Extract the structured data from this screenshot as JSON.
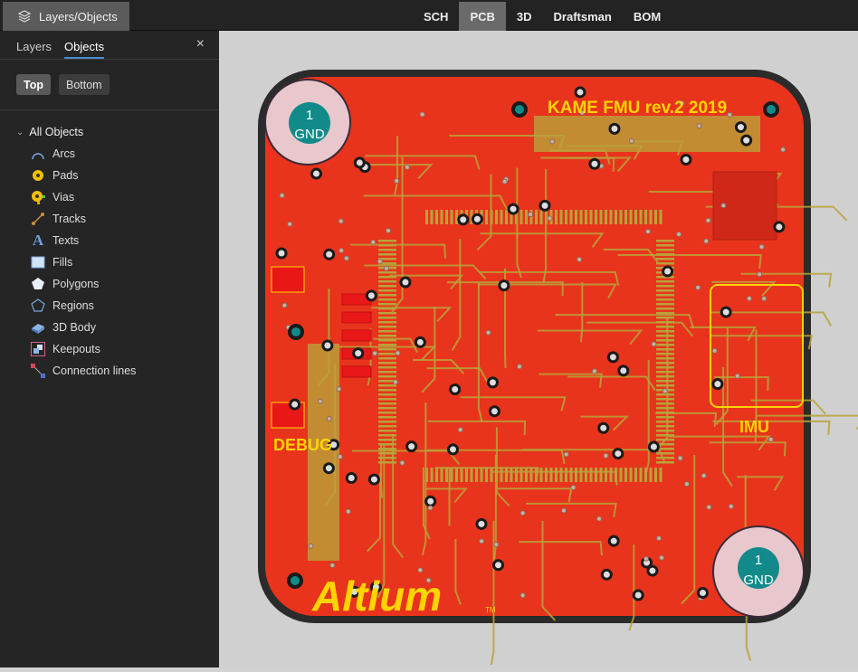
{
  "panel_tab": {
    "label": "Layers/Objects",
    "icon": "layers-icon"
  },
  "doc_tabs": [
    {
      "label": "SCH"
    },
    {
      "label": "PCB",
      "active": true
    },
    {
      "label": "3D"
    },
    {
      "label": "Draftsman"
    },
    {
      "label": "BOM"
    }
  ],
  "sidebar": {
    "tabs": [
      {
        "label": "Layers"
      },
      {
        "label": "Objects",
        "active": true
      }
    ],
    "close": "×",
    "side_buttons": [
      {
        "label": "Top",
        "active": true
      },
      {
        "label": "Bottom"
      }
    ],
    "tree": {
      "root": "All Objects",
      "items": [
        {
          "label": "Arcs",
          "icon": "arc-icon"
        },
        {
          "label": "Pads",
          "icon": "pad-icon"
        },
        {
          "label": "Vias",
          "icon": "via-icon"
        },
        {
          "label": "Tracks",
          "icon": "track-icon"
        },
        {
          "label": "Texts",
          "icon": "text-icon"
        },
        {
          "label": "Fills",
          "icon": "fill-icon"
        },
        {
          "label": "Polygons",
          "icon": "polygon-icon"
        },
        {
          "label": "Regions",
          "icon": "region-icon"
        },
        {
          "label": "3D Body",
          "icon": "3d-body-icon"
        },
        {
          "label": "Keepouts",
          "icon": "keepout-icon"
        },
        {
          "label": "Connection lines",
          "icon": "connection-lines-icon"
        }
      ]
    }
  },
  "pcb": {
    "title": "KAME FMU rev.2 2019",
    "debug": "DEBUG",
    "imu": "IMU",
    "logo": "Altium",
    "tm": "TM",
    "holes": [
      {
        "num": "1",
        "net": "GND"
      },
      {
        "num": "1",
        "net": "GND"
      }
    ],
    "colors": {
      "copper": "#e8341c",
      "silk": "#ffd400",
      "trace": "#b9a23a",
      "board_edge": "#2b2b2b"
    }
  }
}
